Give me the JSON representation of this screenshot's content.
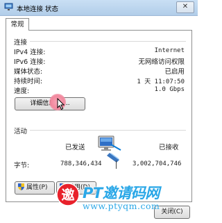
{
  "window": {
    "title": "本地连接 状态",
    "close_glyph": "✕"
  },
  "tabs": [
    {
      "label": "常规"
    }
  ],
  "connection": {
    "heading": "连接",
    "rows": [
      {
        "label": "IPv4 连接:",
        "value": "Internet"
      },
      {
        "label": "IPv6 连接:",
        "value": "无网络访问权限"
      },
      {
        "label": "媒体状态:",
        "value": "已启用"
      },
      {
        "label": "持续时间:",
        "value": "1 天 11:07:50"
      },
      {
        "label": "速度:",
        "value": "1.0 Gbps"
      }
    ],
    "details_button": "详细信息(E)..."
  },
  "activity": {
    "heading": "活动",
    "sent_label": "已发送",
    "received_label": "已接收",
    "bytes_label": "字节:",
    "bytes_sent": "788,346,434",
    "bytes_received": "3,002,704,746"
  },
  "buttons": {
    "properties": "属性(P)",
    "disable": "禁用(D)",
    "close": "关闭(C)"
  },
  "watermark": {
    "title": "PT邀请码网",
    "url": "www.ptyqm.com",
    "logo_char": "邀"
  },
  "icons": {
    "title": "network-icon",
    "shield": "uac-shield-icon",
    "monitor": "network-activity-icon",
    "cursor": "mouse-pointer-icon"
  }
}
